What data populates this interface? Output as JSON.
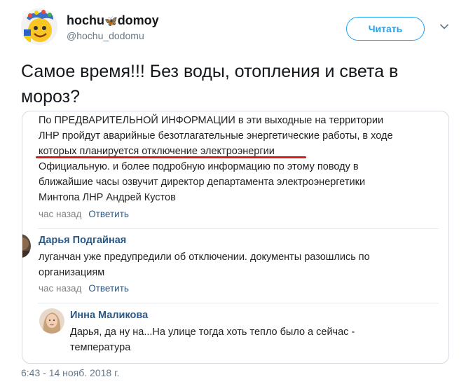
{
  "header": {
    "name_part1": "hochu",
    "name_butterfly": "🦋",
    "name_part2": "domoy",
    "handle": "@hochu_dodomu",
    "follow_label": "Читать",
    "menu_icon": "chevron-down-icon"
  },
  "tweet": {
    "text": "Самое время!!! Без воды, отопления и света в мороз?",
    "timestamp": "6:43 - 14 нояб. 2018 г."
  },
  "screenshot": {
    "post": {
      "lines": [
        "По ПРЕДВАРИТЕЛЬНОЙ ИНФОРМАЦИИ в эти выходные на территории",
        "ЛНР пройдут аварийные безотлагательные энергетические работы, в ходе",
        "которых планируется отключение электроэнергии",
        "Официальную. и более подробную информацию по этому поводу в",
        "ближайшие часы озвучит директор департамента электроэнергетики",
        "Минтопа ЛНР Андрей Кустов"
      ],
      "time": "час назад",
      "reply_label": "Ответить"
    },
    "comments": [
      {
        "author": "Дарья Подгайная",
        "lines": [
          "луганчан уже предупредили об отключении. документы разошлись по",
          "организациям"
        ],
        "time": "час назад",
        "reply_label": "Ответить"
      },
      {
        "author": "Инна Маликова",
        "lines": [
          "Дарья, да ну на...На улице тогда хоть тепло было а сейчас -",
          "температура"
        ]
      }
    ]
  },
  "colors": {
    "twitter_blue": "#1da1f2",
    "vk_link": "#2a5885",
    "underline_red": "#d81b1b"
  }
}
